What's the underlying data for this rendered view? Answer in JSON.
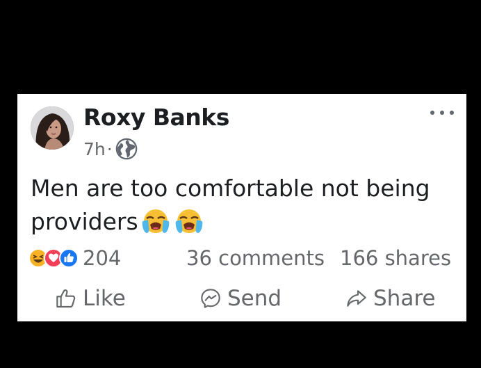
{
  "post": {
    "author": "Roxy Banks",
    "time": "7h",
    "separator": "·",
    "audience_icon": "globe-icon",
    "text": "Men are too comfortable not being providers",
    "emojis": [
      "loudly-crying-face-icon",
      "loudly-crying-face-icon"
    ]
  },
  "stats": {
    "reaction_icons": [
      "haha-icon",
      "love-icon",
      "like-icon"
    ],
    "reaction_count": "204",
    "comments": "36 comments",
    "shares": "166 shares"
  },
  "actions": {
    "like_label": "Like",
    "send_label": "Send",
    "share_label": "Share"
  },
  "colors": {
    "background": "#000000",
    "card": "#ffffff",
    "text_primary": "#1c1e21",
    "text_secondary": "#65676b",
    "like_blue": "#1877f2",
    "love_red": "#f33e58",
    "haha_yellow": "#f7b125"
  }
}
